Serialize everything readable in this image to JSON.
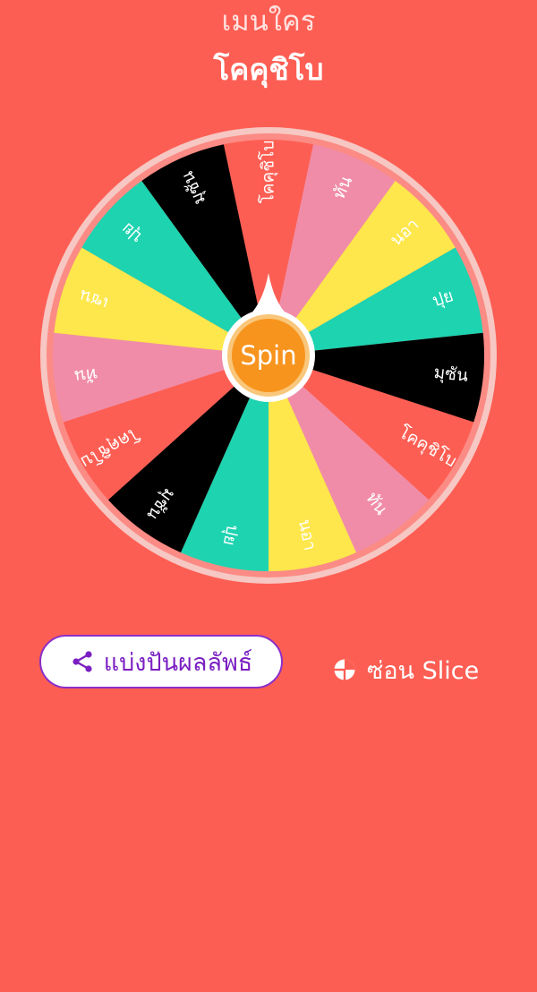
{
  "header": {
    "question": "เมนใคร",
    "result": "โคคุชิโบ"
  },
  "wheel": {
    "spin_label": "Spin",
    "slices": [
      {
        "label": "โคคุชิโบ",
        "color": "#fd5e53"
      },
      {
        "label": "ทัน",
        "color": "#f08ca8"
      },
      {
        "label": "นอา",
        "color": "#fde74c"
      },
      {
        "label": "ปุย",
        "color": "#1dd3b0"
      },
      {
        "label": "มุซัน",
        "color": "#000000"
      },
      {
        "label": "โคคุชิโบ",
        "color": "#fd5e53"
      },
      {
        "label": "ทัน",
        "color": "#f08ca8"
      },
      {
        "label": "นอา",
        "color": "#fde74c"
      },
      {
        "label": "ปุย",
        "color": "#1dd3b0"
      },
      {
        "label": "มุซัน",
        "color": "#000000"
      },
      {
        "label": "โคคุชิโบ",
        "color": "#fd5e53"
      },
      {
        "label": "ทัน",
        "color": "#f08ca8"
      },
      {
        "label": "เซน",
        "color": "#fde74c"
      },
      {
        "label": "ปุย",
        "color": "#1dd3b0"
      },
      {
        "label": "มุซัน",
        "color": "#000000"
      }
    ],
    "hub_color": "#f7941d",
    "pointer_color": "#ffffff"
  },
  "actions": {
    "share_label": "แบ่งปันผลลัพธ์",
    "hide_slice_label": "ซ่อน Slice"
  },
  "colors": {
    "background": "#fd5e53",
    "share_text": "#7b1fc2"
  },
  "icons": {
    "share": "share-icon",
    "hide_slice": "pie-chart-icon"
  }
}
